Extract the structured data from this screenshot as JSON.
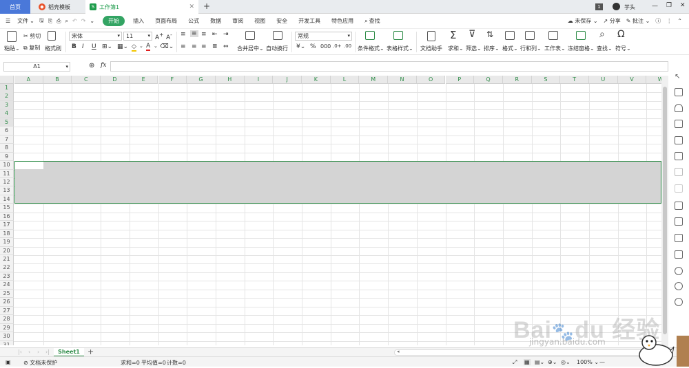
{
  "tabs": {
    "home": "首页",
    "template": "稻壳模板",
    "workbook": "工作簿1",
    "new_tab": "+"
  },
  "titlebar_right": {
    "badge": "1",
    "user": "芋头"
  },
  "menu": {
    "file": "文件",
    "items": [
      "开始",
      "插入",
      "页面布局",
      "公式",
      "数据",
      "审阅",
      "视图",
      "安全",
      "开发工具",
      "特色应用"
    ],
    "search": "查找",
    "unsaved": "未保存",
    "share": "分享",
    "comment": "批注"
  },
  "ribbon": {
    "paste": "粘贴",
    "cut": "剪切",
    "copy": "复制",
    "format_painter": "格式刷",
    "font_name": "宋体",
    "font_size": "11",
    "merge_center": "合并居中",
    "wrap_text": "自动换行",
    "number_format": "常规",
    "conditional_format": "条件格式",
    "table_style": "表格样式",
    "doc_assistant": "文档助手",
    "sum": "求和",
    "filter": "筛选",
    "sort": "排序",
    "format": "格式",
    "row_col": "行和列",
    "worksheet": "工作表",
    "freeze": "冻结窗格",
    "find": "查找",
    "symbol": "符号",
    "bold": "B",
    "italic": "I",
    "underline": "U",
    "font_color_letter": "A"
  },
  "formula_bar": {
    "cell_ref": "A1",
    "fx": "fx",
    "value": ""
  },
  "grid": {
    "columns": [
      "A",
      "B",
      "C",
      "D",
      "E",
      "F",
      "G",
      "H",
      "I",
      "J",
      "K",
      "L",
      "M",
      "N",
      "O",
      "P",
      "Q",
      "R",
      "S",
      "T",
      "U",
      "V",
      "W"
    ],
    "rows": [
      "1",
      "2",
      "3",
      "4",
      "5",
      "6",
      "7",
      "8",
      "9",
      "10",
      "11",
      "12",
      "13",
      "14",
      "15",
      "16",
      "17",
      "18",
      "19",
      "20",
      "21",
      "22",
      "23",
      "24",
      "25",
      "26",
      "27",
      "28",
      "29",
      "30",
      "31"
    ],
    "selected_rows": [
      "1",
      "2",
      "3",
      "4",
      "5"
    ],
    "colors": {
      "accent": "#2c8b46",
      "selection": "#d4d4d4"
    }
  },
  "sheets": {
    "active": "Sheet1",
    "add": "+"
  },
  "status": {
    "protect": "文档未保护",
    "sum": "求和=0",
    "avg": "平均值=0",
    "count": "计数=0",
    "zoom": "100%"
  },
  "watermark": {
    "site": "jingyan.baidu.com"
  }
}
